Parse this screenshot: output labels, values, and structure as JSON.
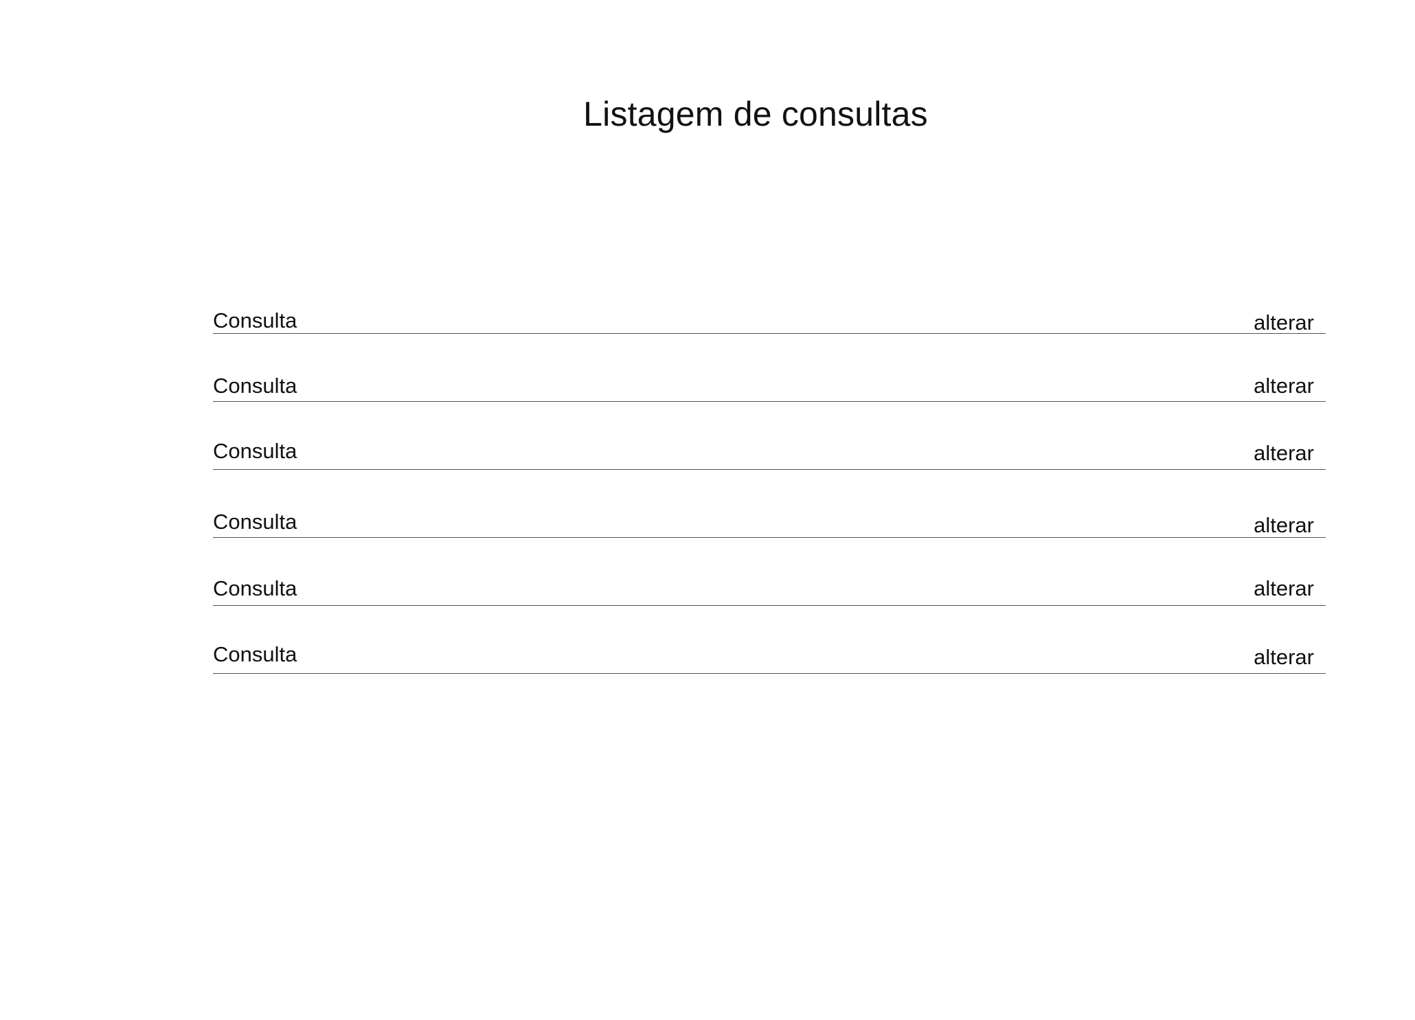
{
  "header": {
    "title": "Listagem de consultas"
  },
  "list": {
    "items": [
      {
        "label": "Consulta",
        "action": "alterar"
      },
      {
        "label": "Consulta",
        "action": "alterar"
      },
      {
        "label": "Consulta",
        "action": "alterar"
      },
      {
        "label": "Consulta",
        "action": "alterar"
      },
      {
        "label": "Consulta",
        "action": "alterar"
      },
      {
        "label": "Consulta",
        "action": "alterar"
      }
    ]
  }
}
